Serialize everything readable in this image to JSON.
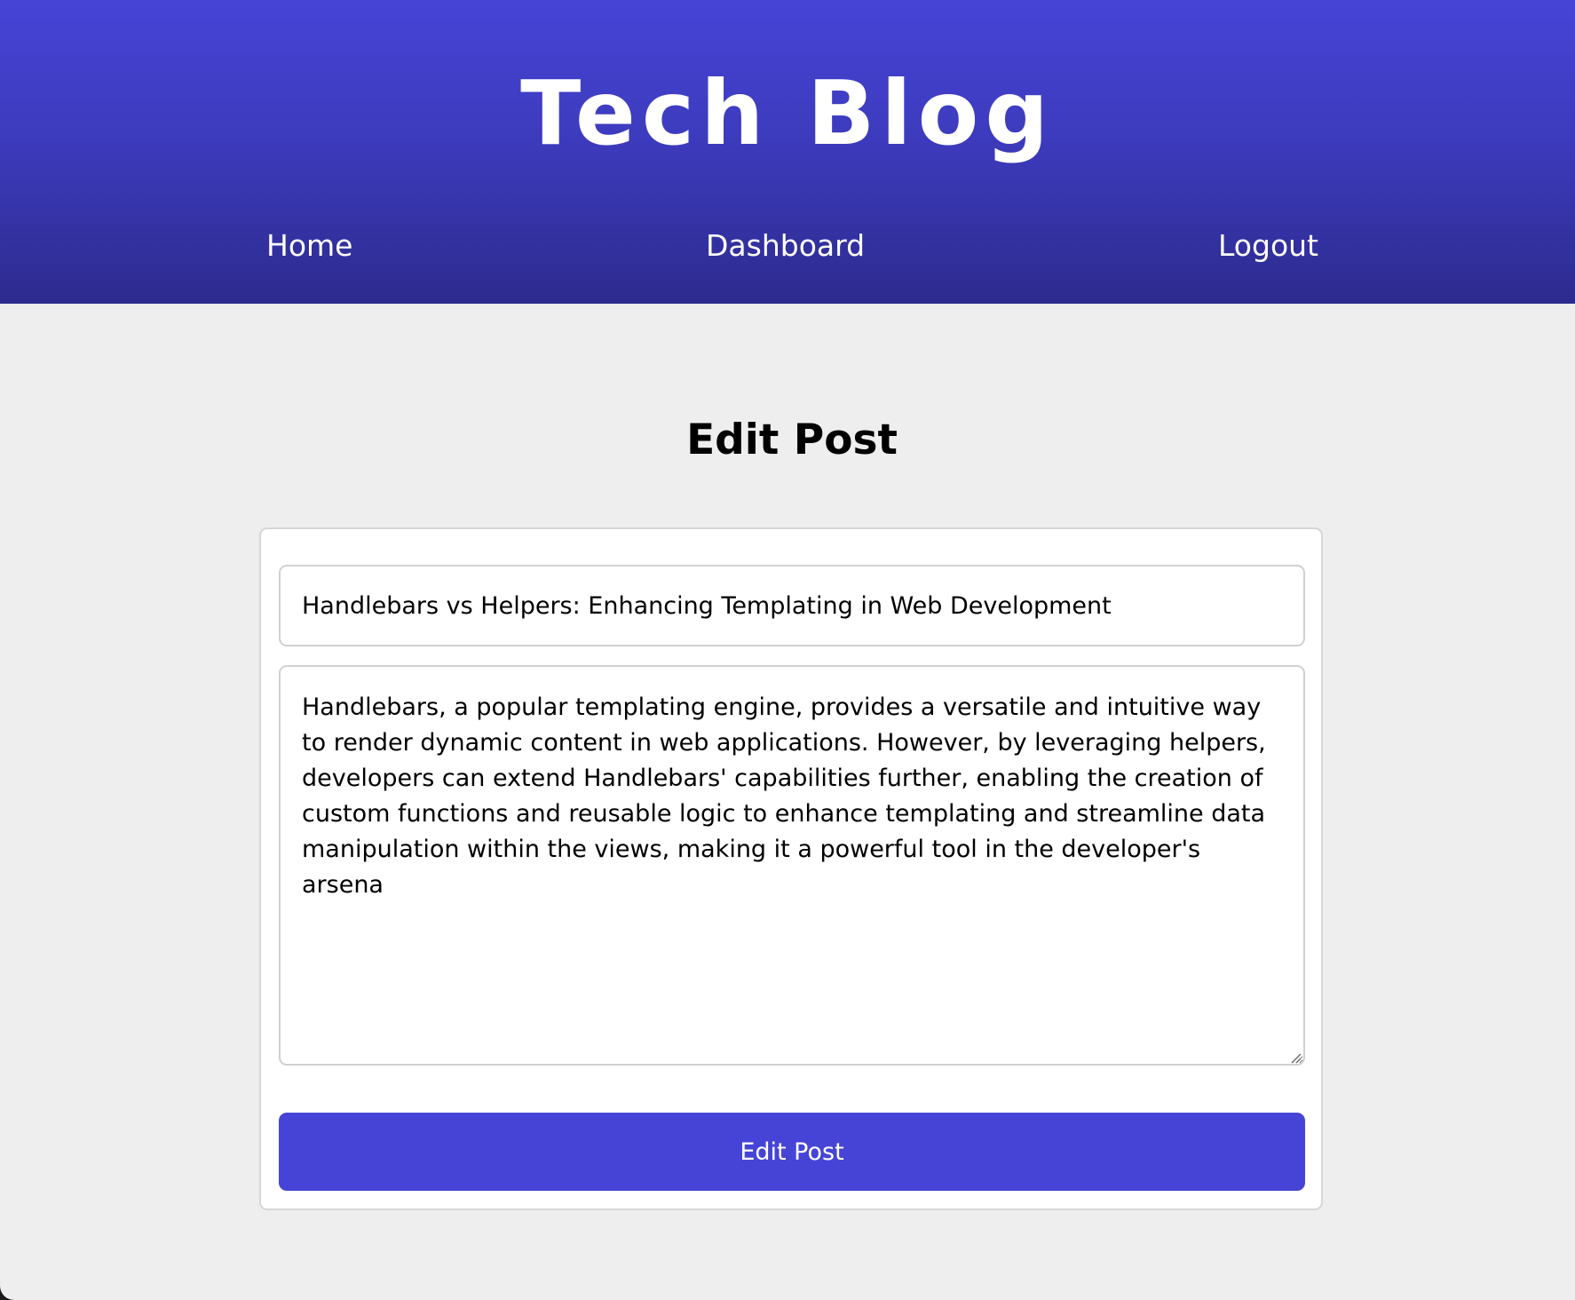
{
  "header": {
    "site_title": "Tech Blog",
    "nav": {
      "home": "Home",
      "dashboard": "Dashboard",
      "logout": "Logout"
    }
  },
  "main": {
    "heading": "Edit Post",
    "form": {
      "title_value": "Handlebars vs Helpers: Enhancing Templating in Web Development",
      "content_value": "Handlebars, a popular templating engine, provides a versatile and intuitive way to render dynamic content in web applications. However, by leveraging helpers, developers can extend Handlebars' capabilities further, enabling the creation of custom functions and reusable logic to enhance templating and streamline data manipulation within the views, making it a powerful tool in the developer's arsena",
      "submit_label": "Edit Post"
    }
  },
  "colors": {
    "header_top": "#4644d6",
    "header_bottom": "#2d2b8e",
    "accent": "#4644d6",
    "page_background": "#eeeeee"
  }
}
